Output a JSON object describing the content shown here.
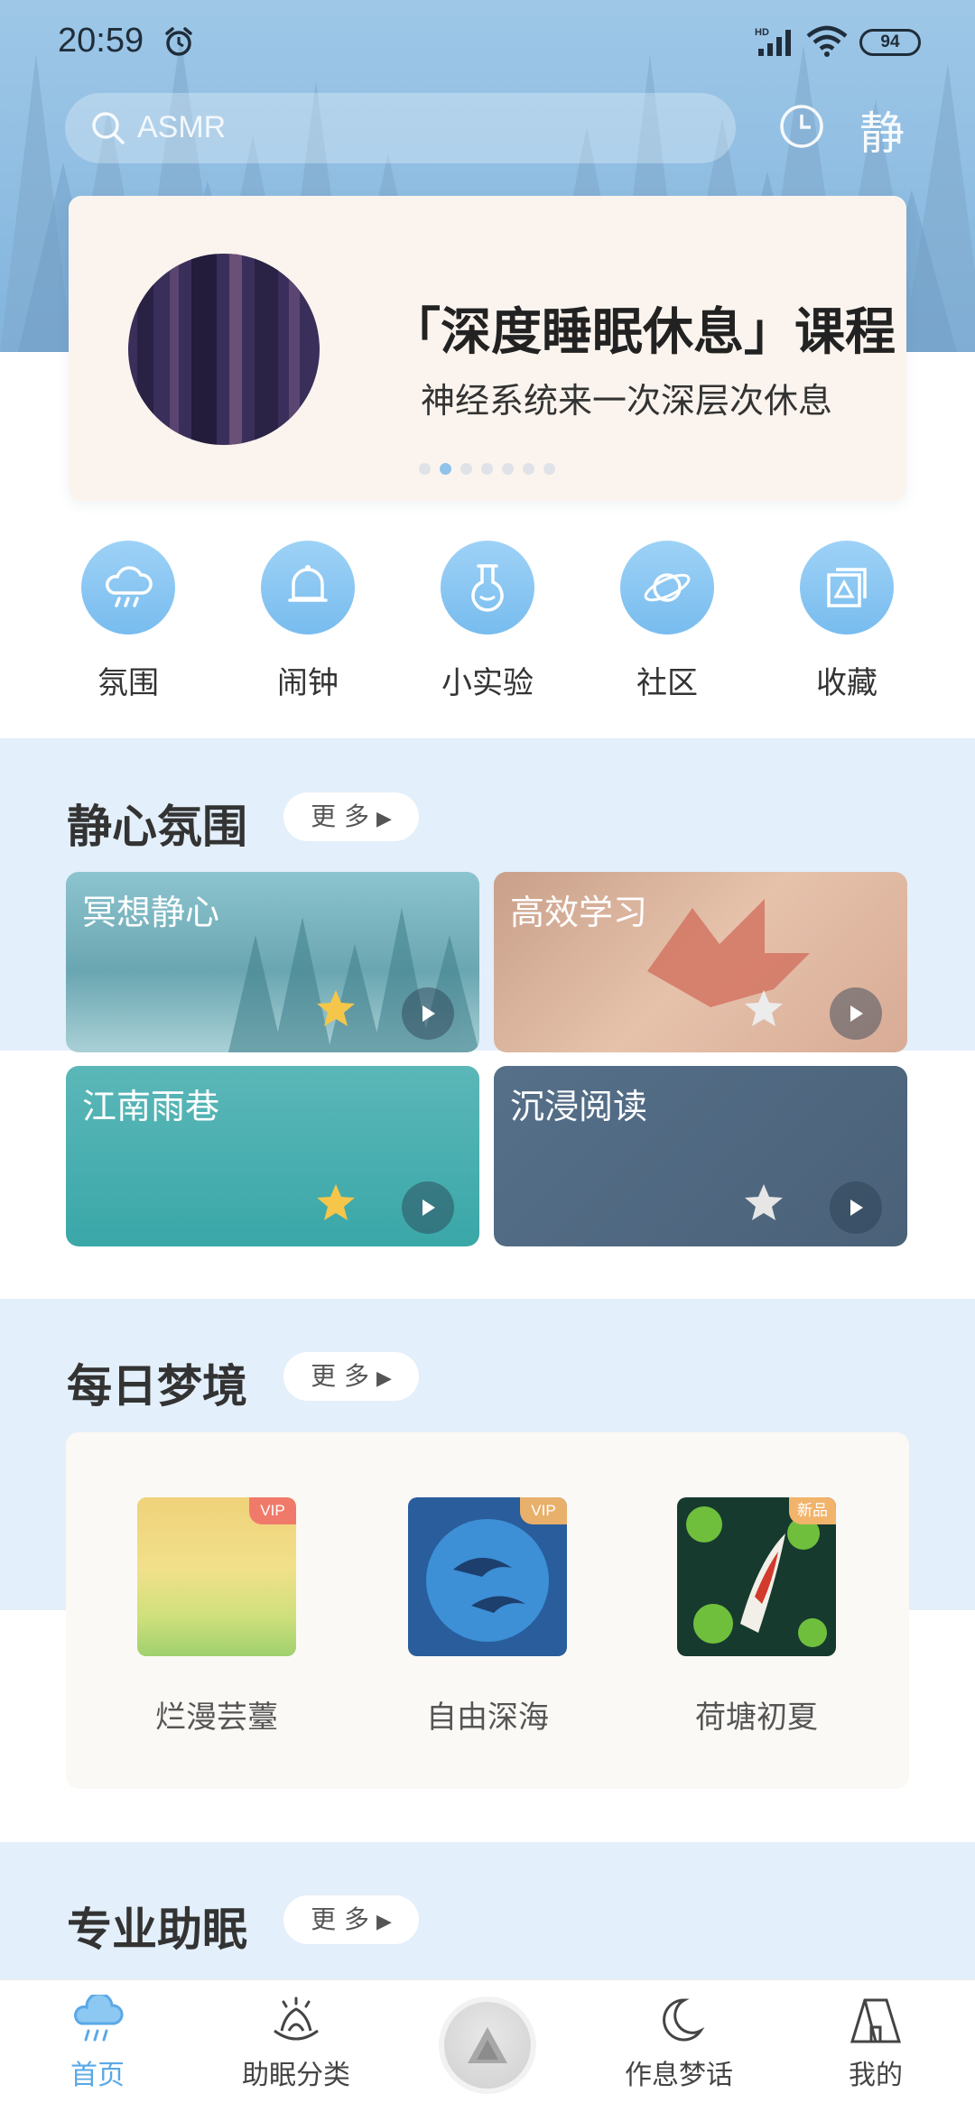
{
  "status_bar": {
    "time": "20:59",
    "battery": "94",
    "network": "HD"
  },
  "search": {
    "placeholder": "ASMR"
  },
  "header": {
    "logo": "静"
  },
  "banner": {
    "title": "「深度睡眠休息」课程",
    "subtitle": "神经系统来一次深层次休息",
    "dot_count": 7,
    "active_dot": 1
  },
  "quick_nav": [
    {
      "label": "氛围",
      "icon": "cloud-rain-icon"
    },
    {
      "label": "闹钟",
      "icon": "bell-icon"
    },
    {
      "label": "小实验",
      "icon": "flask-icon"
    },
    {
      "label": "社区",
      "icon": "planet-icon"
    },
    {
      "label": "收藏",
      "icon": "collection-icon"
    }
  ],
  "section_calm": {
    "title": "静心氛围",
    "more": "更 多",
    "tiles": [
      {
        "label": "冥想静心",
        "favorited": true
      },
      {
        "label": "高效学习",
        "favorited": false
      },
      {
        "label": "江南雨巷",
        "favorited": true
      },
      {
        "label": "沉浸阅读",
        "favorited": false
      }
    ]
  },
  "section_dream": {
    "title": "每日梦境",
    "more": "更 多",
    "items": [
      {
        "label": "烂漫芸薹",
        "badge": "VIP",
        "badge_color": "#f07a6a"
      },
      {
        "label": "自由深海",
        "badge": "VIP",
        "badge_color": "#e8b06a"
      },
      {
        "label": "荷塘初夏",
        "badge": "新品",
        "badge_color": "#f2b36b"
      }
    ]
  },
  "section_pro": {
    "title": "专业助眠",
    "more": "更 多"
  },
  "bottom_nav": [
    {
      "label": "首页",
      "active": true
    },
    {
      "label": "助眠分类",
      "active": false
    },
    {
      "label": "",
      "active": false
    },
    {
      "label": "作息梦话",
      "active": false
    },
    {
      "label": "我的",
      "active": false
    }
  ],
  "colors": {
    "accent": "#5aa8e6",
    "band": "#e3effa",
    "star_on": "#f5c64a",
    "star_off": "#e6e6e6"
  }
}
